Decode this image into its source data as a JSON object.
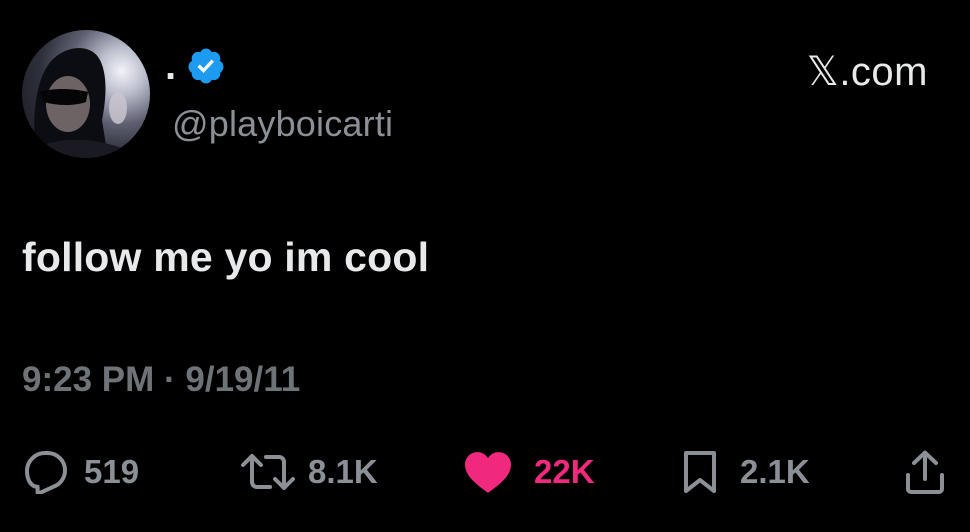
{
  "author": {
    "display_name": ".",
    "handle": "@playboicarti",
    "verified": true,
    "verified_color": "#1d9bf0"
  },
  "brand": {
    "label": "𝕏.com"
  },
  "tweet": {
    "text": "follow me yo im cool",
    "timestamp": "9:23 PM · 9/19/11"
  },
  "actions": {
    "replies": "519",
    "retweets": "8.1K",
    "likes": "22K",
    "likes_color": "#f0297e",
    "bookmarks": "2.1K"
  },
  "icons": {
    "reply": "speech-bubble-icon",
    "retweet": "retweet-arrows-icon",
    "like": "heart-icon",
    "bookmark": "bookmark-icon",
    "share": "share-upload-icon",
    "verified": "verified-badge-icon"
  }
}
